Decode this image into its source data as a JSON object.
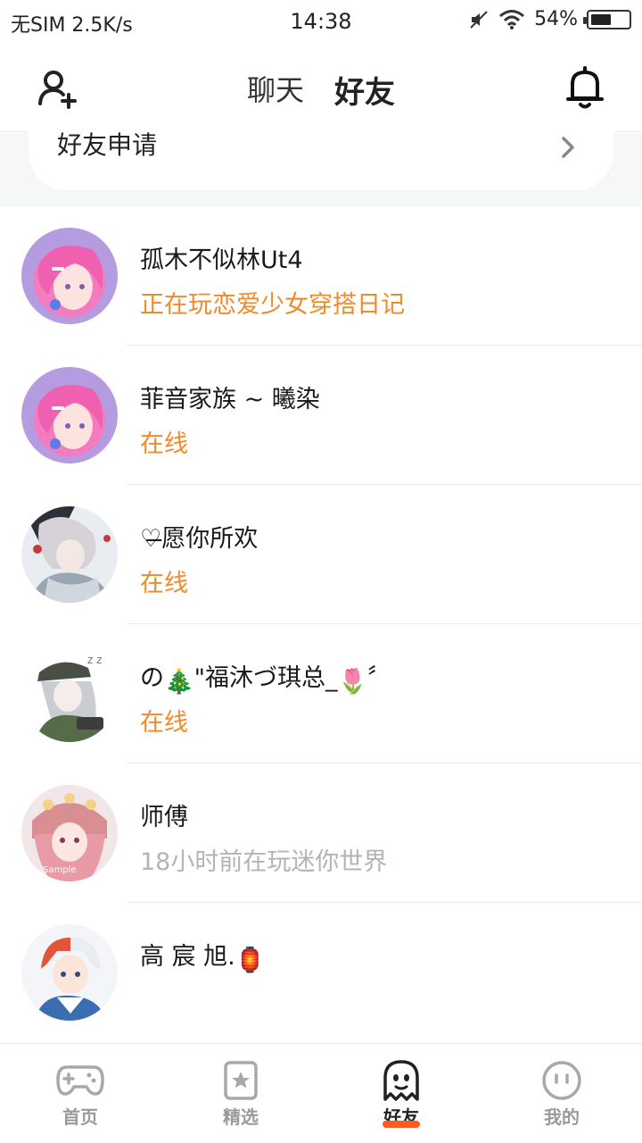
{
  "status_bar": {
    "carrier": "无SIM 2.5K/s",
    "time": "14:38",
    "battery": "54%",
    "battery_level": 0.54,
    "icons": [
      "mute-icon",
      "wifi-icon",
      "battery-icon"
    ]
  },
  "header": {
    "tabs": [
      {
        "label": "聊天",
        "active": false
      },
      {
        "label": "好友",
        "active": true
      }
    ],
    "left_icon": "add-friend-icon",
    "right_icon": "bell-icon"
  },
  "friend_request": {
    "label": "好友申请",
    "icon": "chevron-right-icon"
  },
  "friends": [
    {
      "name": "孤木不似林Ut4",
      "status": "正在玩恋爱少女穿搭日记",
      "status_color": "#f08a2a",
      "avatar": "avatar-pink-hair"
    },
    {
      "name": "菲音家族 ~ 曦染",
      "status": "在线",
      "status_color": "#f08a2a",
      "avatar": "avatar-pink-hair"
    },
    {
      "name": "♡̶愿你所欢",
      "status": "在线",
      "status_color": "#f08a2a",
      "avatar": "avatar-white-hair"
    },
    {
      "name_prefix": "の",
      "name_emoji_1": "🎄",
      "name_mid": "\"福沐づ琪总_",
      "name_emoji_2": "🌷",
      "name_suffix": "〞",
      "status": "在线",
      "status_color": "#f08a2a",
      "avatar": "avatar-cap-girl"
    },
    {
      "name": "师傅",
      "status": "18小时前在玩迷你世界",
      "status_color": "#b4b4b4",
      "avatar": "avatar-sample-girl"
    },
    {
      "name_text": "高 宸 旭.",
      "name_emoji": "🏮",
      "status": "",
      "status_color": "#f08a2a",
      "avatar": "avatar-red-hair-boy"
    }
  ],
  "bottom_nav": [
    {
      "label": "首页",
      "icon": "gamepad-icon",
      "active": false
    },
    {
      "label": "精选",
      "icon": "star-bookmark-icon",
      "active": false
    },
    {
      "label": "好友",
      "icon": "ghost-icon",
      "active": true
    },
    {
      "label": "我的",
      "icon": "face-icon",
      "active": false
    }
  ],
  "colors": {
    "accent": "#ff5a1f",
    "online": "#f08a2a",
    "offline": "#b4b4b4"
  }
}
